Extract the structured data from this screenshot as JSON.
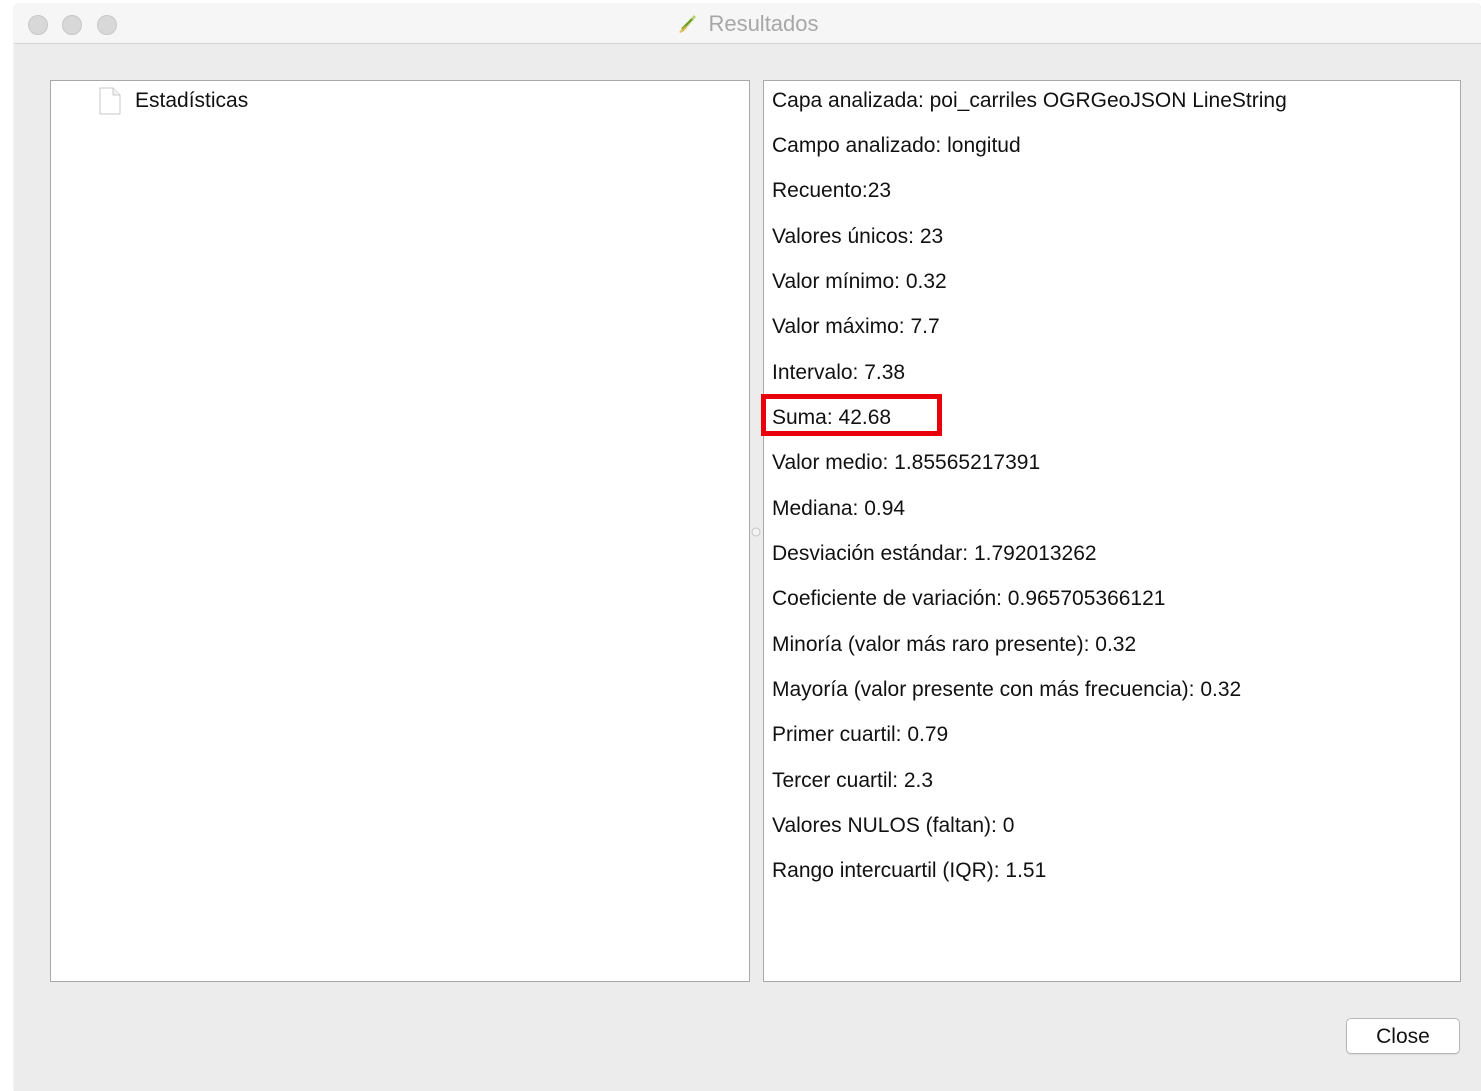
{
  "window": {
    "title": "Resultados"
  },
  "tree": {
    "items": [
      {
        "label": "Estadísticas",
        "icon": "document-icon"
      }
    ]
  },
  "results": {
    "lines": [
      "Capa analizada: poi_carriles OGRGeoJSON LineString",
      "Campo analizado: longitud",
      "Recuento:23",
      "Valores únicos: 23",
      "Valor mínimo: 0.32",
      "Valor máximo: 7.7",
      "Intervalo: 7.38",
      "Suma: 42.68",
      "Valor medio: 1.85565217391",
      "Mediana: 0.94",
      "Desviación estándar: 1.792013262",
      "Coeficiente de variación: 0.965705366121",
      "Minoría (valor más raro presente): 0.32",
      "Mayoría (valor presente con más frecuencia): 0.32",
      "Primer cuartil: 0.79",
      "Tercer cuartil: 2.3",
      "Valores NULOS (faltan): 0",
      "Rango intercuartil (IQR): 1.51"
    ],
    "highlighted_line": "Suma: 42.68",
    "highlight_color": "#e8000b"
  },
  "buttons": {
    "close_label": "Close"
  }
}
